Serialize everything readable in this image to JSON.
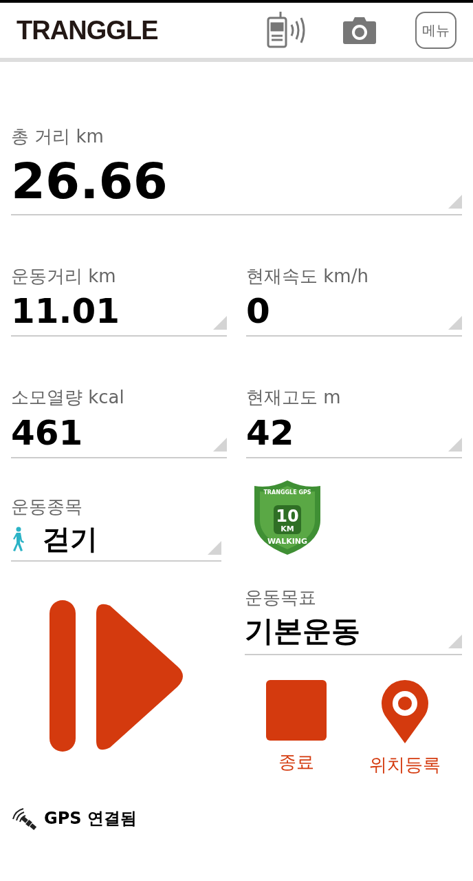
{
  "header": {
    "logo": "TRANGGLE",
    "menu_button": "메뉴"
  },
  "total": {
    "label": "총 거리 km",
    "value": "26.66"
  },
  "stats": [
    {
      "label": "운동거리 km",
      "value": "11.01"
    },
    {
      "label": "현재속도 km/h",
      "value": "0"
    },
    {
      "label": "소모열량 kcal",
      "value": "461"
    },
    {
      "label": "현재고도 m",
      "value": "42"
    }
  ],
  "activity": {
    "label": "운동종목",
    "value": "걷기"
  },
  "badge": {
    "top": "TRANGGLE GPS",
    "number": "10",
    "unit": "KM",
    "bottom": "WALKING"
  },
  "goal": {
    "label": "운동목표",
    "value": "기본운동"
  },
  "controls": [
    {
      "kind": "stop",
      "label": "종료"
    },
    {
      "kind": "pin",
      "label": "위치등록"
    }
  ],
  "status": {
    "text": "GPS 연결됨"
  }
}
